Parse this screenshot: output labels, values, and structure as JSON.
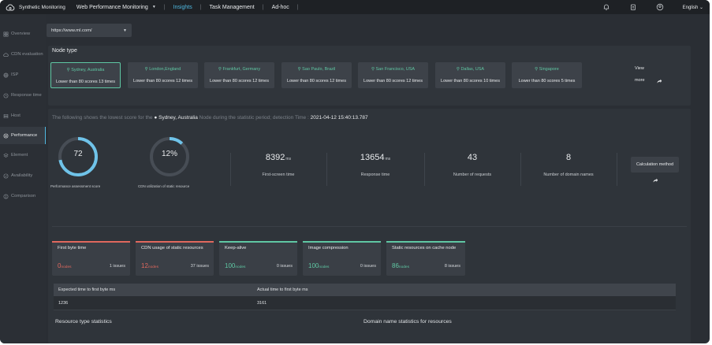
{
  "header": {
    "brand": "Synthetic Monitoring",
    "nav": [
      {
        "label": "Web Performance Monitoring",
        "active": false
      },
      {
        "label": "Insights",
        "active": true
      },
      {
        "label": "Task Management",
        "active": false
      },
      {
        "label": "Ad-hoc",
        "active": false
      }
    ],
    "icons": [
      "bell-icon",
      "clipboard-icon",
      "user-icon"
    ],
    "language": "English"
  },
  "sidebar": {
    "items": [
      {
        "label": "Overview",
        "icon": "grid-icon",
        "active": false
      },
      {
        "label": "CDN evaluation",
        "icon": "cloud-icon",
        "active": false
      },
      {
        "label": "ISP",
        "icon": "globe-icon",
        "active": false
      },
      {
        "label": "Response time",
        "icon": "clock-icon",
        "active": false
      },
      {
        "label": "Host",
        "icon": "server-icon",
        "active": false
      },
      {
        "label": "Performance",
        "icon": "gauge-icon",
        "active": true
      },
      {
        "label": "Element",
        "icon": "layers-icon",
        "active": false
      },
      {
        "label": "Availability",
        "icon": "check-circle-icon",
        "active": false
      },
      {
        "label": "Comparison",
        "icon": "compare-icon",
        "active": false
      }
    ]
  },
  "url_select": {
    "value": "https://www.ml.com/"
  },
  "node_type": {
    "title": "Node type",
    "nodes": [
      {
        "location": "Sydney, Australia",
        "summary": "Lower than 80 scores 13 times",
        "selected": true
      },
      {
        "location": "London,England",
        "summary": "Lower than 80 scores 12 times",
        "selected": false
      },
      {
        "location": "Frankfurt, Germany",
        "summary": "Lower than 80 scores 12 times",
        "selected": false
      },
      {
        "location": "Sao Paulo, Brazil",
        "summary": "Lower than 80 scores 12 times",
        "selected": false
      },
      {
        "location": "San Francisco, USA",
        "summary": "Lower than 80 scores 12 times",
        "selected": false
      },
      {
        "location": "Dallas, USA",
        "summary": "Lower than 80 scores 10 times",
        "selected": false
      },
      {
        "location": "Singapore",
        "summary": "Lower than 80 scores 5 times",
        "selected": false
      }
    ],
    "view_more_top": "View",
    "view_more_bottom": "more"
  },
  "statement": {
    "prefix": "The following shows the lowest score for the",
    "node": "Sydney, Australia",
    "middle": "Node   during the statistic period; detection Time :",
    "time": "2021-04-12 15:40:13.787"
  },
  "gauges": [
    {
      "value": "72",
      "fraction": 0.72,
      "label": "Performance assessment score"
    },
    {
      "value": "12%",
      "fraction": 0.12,
      "label": "CDN utilization of static resource"
    }
  ],
  "metrics": [
    {
      "value": "8392",
      "unit": "ms",
      "label": "First-screen time"
    },
    {
      "value": "13654",
      "unit": "ms",
      "label": "Response time"
    },
    {
      "value": "43",
      "unit": "",
      "label": "Number of requests"
    },
    {
      "value": "8",
      "unit": "",
      "label": "Number of domain names"
    }
  ],
  "calc_button": "Calculation method",
  "issues": [
    {
      "title": "First byte time",
      "count": "0",
      "unit": "nodes",
      "issues": "1 issues",
      "status": "bad"
    },
    {
      "title": "CDN usage of static resources",
      "count": "12",
      "unit": "nodes",
      "issues": "37 issues",
      "status": "bad"
    },
    {
      "title": "Keep-alive",
      "count": "100",
      "unit": "nodes",
      "issues": "0 issues",
      "status": "good"
    },
    {
      "title": "Image compression",
      "count": "100",
      "unit": "nodes",
      "issues": "0 issues",
      "status": "good"
    },
    {
      "title": "Static resources on cache node",
      "count": "86",
      "unit": "nodes",
      "issues": "8 issues",
      "status": "good"
    }
  ],
  "colors": {
    "bad": "#e0685e",
    "good": "#5fc7a3",
    "accent": "#4fb8e0"
  },
  "byte_table": {
    "headers": [
      "Expected time to first byte ms",
      "Actual time to first byte ms"
    ],
    "row": [
      "1236",
      "3161"
    ]
  },
  "sections": {
    "resource_type": "Resource type statistics",
    "domain_name": "Domain name statistics for resources"
  }
}
